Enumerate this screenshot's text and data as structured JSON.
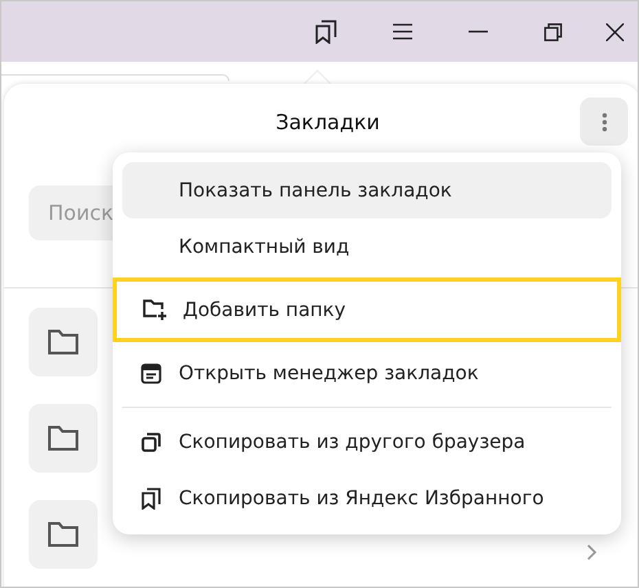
{
  "panel": {
    "title": "Закладки",
    "search": {
      "placeholder": "Поиск"
    },
    "folders": [
      {
        "kind": "folder"
      },
      {
        "kind": "folder"
      },
      {
        "kind": "folder"
      }
    ]
  },
  "menu": {
    "items": [
      {
        "kind": "plain",
        "label": "Показать панель закладок",
        "selected": true,
        "focused": false
      },
      {
        "kind": "plain",
        "label": "Компактный вид",
        "selected": false,
        "focused": false
      },
      {
        "kind": "folder-add",
        "label": "Добавить папку",
        "selected": false,
        "focused": true
      },
      {
        "kind": "manager",
        "label": "Открыть менеджер закладок",
        "selected": false,
        "focused": false
      },
      {
        "kind": "divider"
      },
      {
        "kind": "copy",
        "label": "Скопировать из другого браузера",
        "selected": false,
        "focused": false
      },
      {
        "kind": "bookmarks",
        "label": "Скопировать из Яндекс Избранного",
        "selected": false,
        "focused": false
      }
    ]
  }
}
